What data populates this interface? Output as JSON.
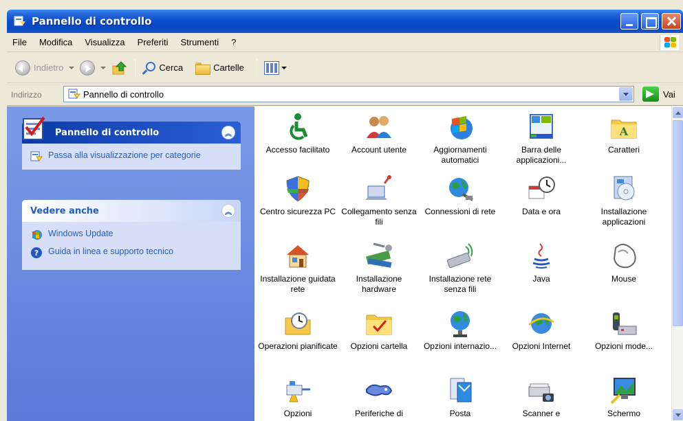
{
  "window": {
    "title": "Pannello di controllo"
  },
  "menu": [
    "File",
    "Modifica",
    "Visualizza",
    "Preferiti",
    "Strumenti",
    "?"
  ],
  "toolbar": {
    "back_label": "Indietro",
    "search_label": "Cerca",
    "folders_label": "Cartelle"
  },
  "address": {
    "label": "Indirizzo",
    "value": "Pannello di controllo",
    "go_label": "Vai"
  },
  "left": {
    "panel1": {
      "title": "Pannello di controllo",
      "link": "Passa alla visualizzazione per categorie"
    },
    "panel2": {
      "title": "Vedere anche",
      "links": [
        "Windows Update",
        "Guida in linea e supporto tecnico"
      ]
    }
  },
  "items": [
    {
      "label": "Accesso facilitato",
      "icon": "accessibility-icon"
    },
    {
      "label": "Account utente",
      "icon": "user-accounts-icon"
    },
    {
      "label": "Aggiornamenti automatici",
      "icon": "windows-update-globe-icon"
    },
    {
      "label": "Barra delle applicazioni...",
      "icon": "taskbar-icon"
    },
    {
      "label": "Caratteri",
      "icon": "fonts-folder-icon"
    },
    {
      "label": "Centro sicurezza PC",
      "icon": "security-shield-icon"
    },
    {
      "label": "Collegamento senza fili",
      "icon": "wireless-link-icon"
    },
    {
      "label": "Connessioni di rete",
      "icon": "network-globe-icon"
    },
    {
      "label": "Data e ora",
      "icon": "date-time-icon"
    },
    {
      "label": "Installazione applicazioni",
      "icon": "add-remove-programs-icon"
    },
    {
      "label": "Installazione guidata rete",
      "icon": "network-setup-house-icon"
    },
    {
      "label": "Installazione hardware",
      "icon": "add-hardware-icon"
    },
    {
      "label": "Installazione rete senza fili",
      "icon": "wireless-network-setup-icon"
    },
    {
      "label": "Java",
      "icon": "java-cup-icon"
    },
    {
      "label": "Mouse",
      "icon": "mouse-icon"
    },
    {
      "label": "Operazioni pianificate",
      "icon": "scheduled-tasks-icon"
    },
    {
      "label": "Opzioni cartella",
      "icon": "folder-options-icon"
    },
    {
      "label": "Opzioni internazio...",
      "icon": "regional-globe-icon"
    },
    {
      "label": "Opzioni Internet",
      "icon": "internet-globe-icon"
    },
    {
      "label": "Opzioni mode...",
      "icon": "phone-modem-icon"
    },
    {
      "label": "Opzioni",
      "icon": "power-options-icon"
    },
    {
      "label": "Periferiche di",
      "icon": "game-controllers-icon"
    },
    {
      "label": "Posta",
      "icon": "mail-icon"
    },
    {
      "label": "Scanner e",
      "icon": "scanner-camera-icon"
    },
    {
      "label": "Schermo",
      "icon": "display-icon"
    }
  ]
}
